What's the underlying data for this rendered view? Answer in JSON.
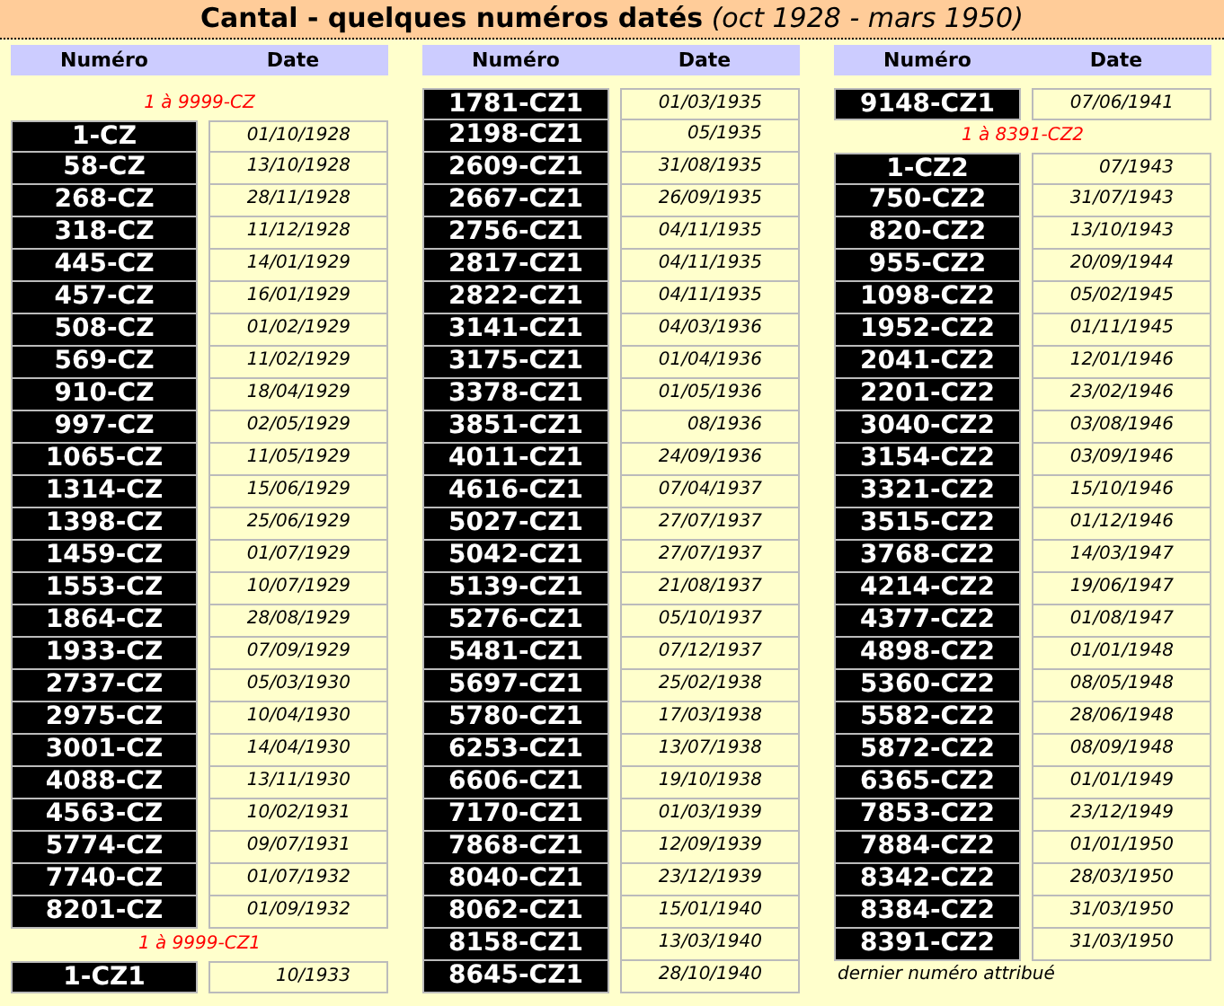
{
  "title": "**Cantal - quelques numéros datés** *(oct 1928 - mars 1950)*",
  "columns": [
    {
      "headers": {
        "number": "Numéro",
        "date": "Date"
      },
      "entries": [
        {
          "kind": "range",
          "text": "1 à 9999-CZ"
        },
        {
          "kind": "plate",
          "number": "1-CZ",
          "date": "01/10/1928"
        },
        {
          "kind": "plate",
          "number": "58-CZ",
          "date": "13/10/1928"
        },
        {
          "kind": "plate",
          "number": "268-CZ",
          "date": "28/11/1928"
        },
        {
          "kind": "plate",
          "number": "318-CZ",
          "date": "11/12/1928"
        },
        {
          "kind": "plate",
          "number": "445-CZ",
          "date": "14/01/1929"
        },
        {
          "kind": "plate",
          "number": "457-CZ",
          "date": "16/01/1929"
        },
        {
          "kind": "plate",
          "number": "508-CZ",
          "date": "01/02/1929"
        },
        {
          "kind": "plate",
          "number": "569-CZ",
          "date": "11/02/1929"
        },
        {
          "kind": "plate",
          "number": "910-CZ",
          "date": "18/04/1929"
        },
        {
          "kind": "plate",
          "number": "997-CZ",
          "date": "02/05/1929"
        },
        {
          "kind": "plate",
          "number": "1065-CZ",
          "date": "11/05/1929"
        },
        {
          "kind": "plate",
          "number": "1314-CZ",
          "date": "15/06/1929"
        },
        {
          "kind": "plate",
          "number": "1398-CZ",
          "date": "25/06/1929"
        },
        {
          "kind": "plate",
          "number": "1459-CZ",
          "date": "01/07/1929"
        },
        {
          "kind": "plate",
          "number": "1553-CZ",
          "date": "10/07/1929"
        },
        {
          "kind": "plate",
          "number": "1864-CZ",
          "date": "28/08/1929"
        },
        {
          "kind": "plate",
          "number": "1933-CZ",
          "date": "07/09/1929"
        },
        {
          "kind": "plate",
          "number": "2737-CZ",
          "date": "05/03/1930"
        },
        {
          "kind": "plate",
          "number": "2975-CZ",
          "date": "10/04/1930"
        },
        {
          "kind": "plate",
          "number": "3001-CZ",
          "date": "14/04/1930"
        },
        {
          "kind": "plate",
          "number": "4088-CZ",
          "date": "13/11/1930"
        },
        {
          "kind": "plate",
          "number": "4563-CZ",
          "date": "10/02/1931"
        },
        {
          "kind": "plate",
          "number": "5774-CZ",
          "date": "09/07/1931"
        },
        {
          "kind": "plate",
          "number": "7740-CZ",
          "date": "01/07/1932"
        },
        {
          "kind": "plate",
          "number": "8201-CZ",
          "date": "01/09/1932"
        },
        {
          "kind": "range",
          "text": "1 à 9999-CZ1"
        },
        {
          "kind": "plate",
          "number": "1-CZ1",
          "date": "10/1933"
        }
      ]
    },
    {
      "headers": {
        "number": "Numéro",
        "date": "Date"
      },
      "entries": [
        {
          "kind": "plate",
          "number": "1781-CZ1",
          "date": "01/03/1935"
        },
        {
          "kind": "plate",
          "number": "2198-CZ1",
          "date": "05/1935"
        },
        {
          "kind": "plate",
          "number": "2609-CZ1",
          "date": "31/08/1935"
        },
        {
          "kind": "plate",
          "number": "2667-CZ1",
          "date": "26/09/1935"
        },
        {
          "kind": "plate",
          "number": "2756-CZ1",
          "date": "04/11/1935"
        },
        {
          "kind": "plate",
          "number": "2817-CZ1",
          "date": "04/11/1935"
        },
        {
          "kind": "plate",
          "number": "2822-CZ1",
          "date": "04/11/1935"
        },
        {
          "kind": "plate",
          "number": "3141-CZ1",
          "date": "04/03/1936"
        },
        {
          "kind": "plate",
          "number": "3175-CZ1",
          "date": "01/04/1936"
        },
        {
          "kind": "plate",
          "number": "3378-CZ1",
          "date": "01/05/1936"
        },
        {
          "kind": "plate",
          "number": "3851-CZ1",
          "date": "08/1936"
        },
        {
          "kind": "plate",
          "number": "4011-CZ1",
          "date": "24/09/1936"
        },
        {
          "kind": "plate",
          "number": "4616-CZ1",
          "date": "07/04/1937"
        },
        {
          "kind": "plate",
          "number": "5027-CZ1",
          "date": "27/07/1937"
        },
        {
          "kind": "plate",
          "number": "5042-CZ1",
          "date": "27/07/1937"
        },
        {
          "kind": "plate",
          "number": "5139-CZ1",
          "date": "21/08/1937"
        },
        {
          "kind": "plate",
          "number": "5276-CZ1",
          "date": "05/10/1937"
        },
        {
          "kind": "plate",
          "number": "5481-CZ1",
          "date": "07/12/1937"
        },
        {
          "kind": "plate",
          "number": "5697-CZ1",
          "date": "25/02/1938"
        },
        {
          "kind": "plate",
          "number": "5780-CZ1",
          "date": "17/03/1938"
        },
        {
          "kind": "plate",
          "number": "6253-CZ1",
          "date": "13/07/1938"
        },
        {
          "kind": "plate",
          "number": "6606-CZ1",
          "date": "19/10/1938"
        },
        {
          "kind": "plate",
          "number": "7170-CZ1",
          "date": "01/03/1939"
        },
        {
          "kind": "plate",
          "number": "7868-CZ1",
          "date": "12/09/1939"
        },
        {
          "kind": "plate",
          "number": "8040-CZ1",
          "date": "23/12/1939"
        },
        {
          "kind": "plate",
          "number": "8062-CZ1",
          "date": "15/01/1940"
        },
        {
          "kind": "plate",
          "number": "8158-CZ1",
          "date": "13/03/1940"
        },
        {
          "kind": "plate",
          "number": "8645-CZ1",
          "date": "28/10/1940"
        }
      ]
    },
    {
      "headers": {
        "number": "Numéro",
        "date": "Date"
      },
      "entries": [
        {
          "kind": "plate",
          "number": "9148-CZ1",
          "date": "07/06/1941"
        },
        {
          "kind": "range",
          "text": "1 à 8391-CZ2"
        },
        {
          "kind": "plate",
          "number": "1-CZ2",
          "date": "07/1943"
        },
        {
          "kind": "plate",
          "number": "750-CZ2",
          "date": "31/07/1943"
        },
        {
          "kind": "plate",
          "number": "820-CZ2",
          "date": "13/10/1943"
        },
        {
          "kind": "plate",
          "number": "955-CZ2",
          "date": "20/09/1944"
        },
        {
          "kind": "plate",
          "number": "1098-CZ2",
          "date": "05/02/1945"
        },
        {
          "kind": "plate",
          "number": "1952-CZ2",
          "date": "01/11/1945"
        },
        {
          "kind": "plate",
          "number": "2041-CZ2",
          "date": "12/01/1946"
        },
        {
          "kind": "plate",
          "number": "2201-CZ2",
          "date": "23/02/1946"
        },
        {
          "kind": "plate",
          "number": "3040-CZ2",
          "date": "03/08/1946"
        },
        {
          "kind": "plate",
          "number": "3154-CZ2",
          "date": "03/09/1946"
        },
        {
          "kind": "plate",
          "number": "3321-CZ2",
          "date": "15/10/1946"
        },
        {
          "kind": "plate",
          "number": "3515-CZ2",
          "date": "01/12/1946"
        },
        {
          "kind": "plate",
          "number": "3768-CZ2",
          "date": "14/03/1947"
        },
        {
          "kind": "plate",
          "number": "4214-CZ2",
          "date": "19/06/1947"
        },
        {
          "kind": "plate",
          "number": "4377-CZ2",
          "date": "01/08/1947"
        },
        {
          "kind": "plate",
          "number": "4898-CZ2",
          "date": "01/01/1948"
        },
        {
          "kind": "plate",
          "number": "5360-CZ2",
          "date": "08/05/1948"
        },
        {
          "kind": "plate",
          "number": "5582-CZ2",
          "date": "28/06/1948"
        },
        {
          "kind": "plate",
          "number": "5872-CZ2",
          "date": "08/09/1948"
        },
        {
          "kind": "plate",
          "number": "6365-CZ2",
          "date": "01/01/1949"
        },
        {
          "kind": "plate",
          "number": "7853-CZ2",
          "date": "23/12/1949"
        },
        {
          "kind": "plate",
          "number": "7884-CZ2",
          "date": "01/01/1950"
        },
        {
          "kind": "plate",
          "number": "8342-CZ2",
          "date": "28/03/1950"
        },
        {
          "kind": "plate",
          "number": "8384-CZ2",
          "date": "31/03/1950"
        },
        {
          "kind": "plate",
          "number": "8391-CZ2",
          "date": "31/03/1950"
        },
        {
          "kind": "note",
          "text": "dernier numéro attribué"
        }
      ]
    }
  ]
}
